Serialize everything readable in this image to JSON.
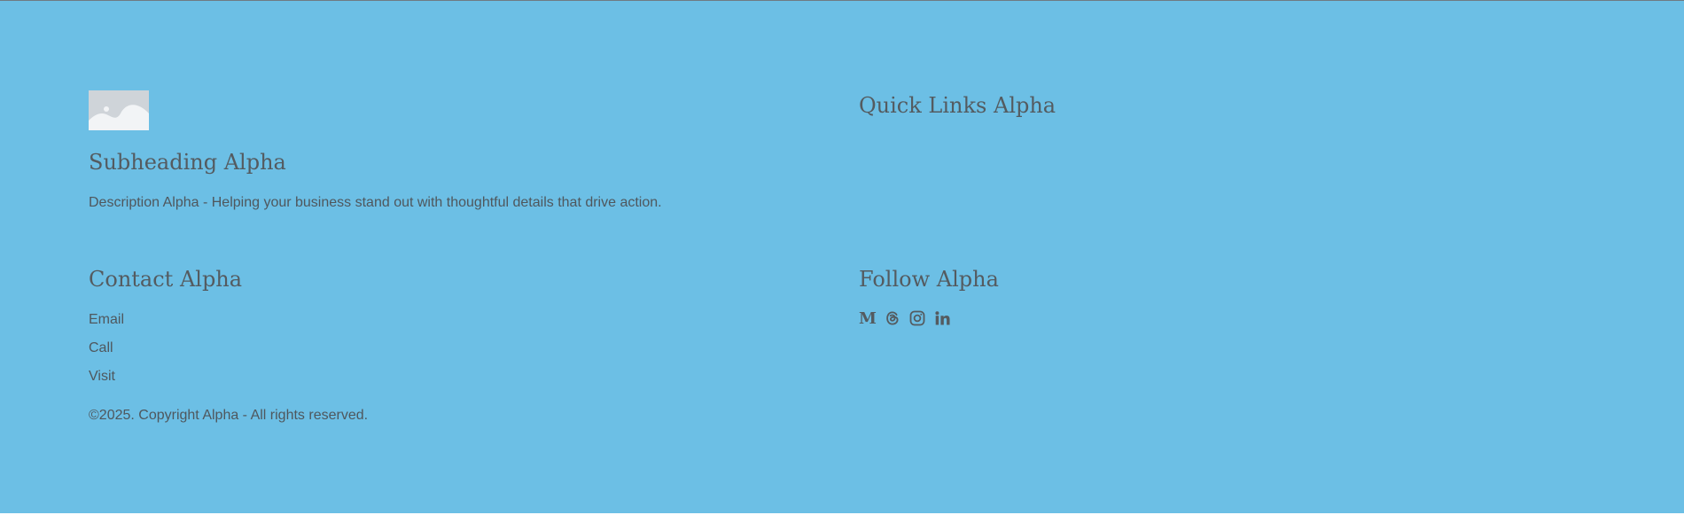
{
  "footer": {
    "brand": {
      "subheading": "Subheading Alpha",
      "description": "Description Alpha - Helping your business stand out with thoughtful details that drive action.",
      "logo_icon": "image-placeholder-icon"
    },
    "quick_links": {
      "heading": "Quick Links Alpha"
    },
    "contact": {
      "heading": "Contact Alpha",
      "items": [
        "Email",
        "Call",
        "Visit"
      ]
    },
    "follow": {
      "heading": "Follow Alpha",
      "icons": [
        "medium-icon",
        "threads-icon",
        "instagram-icon",
        "linkedin-icon"
      ]
    },
    "copyright": "©2025. Copyright Alpha - All rights reserved."
  },
  "colors": {
    "background": "#6cbfe5",
    "text": "#545b60",
    "placeholder": "#cfd4d9"
  }
}
